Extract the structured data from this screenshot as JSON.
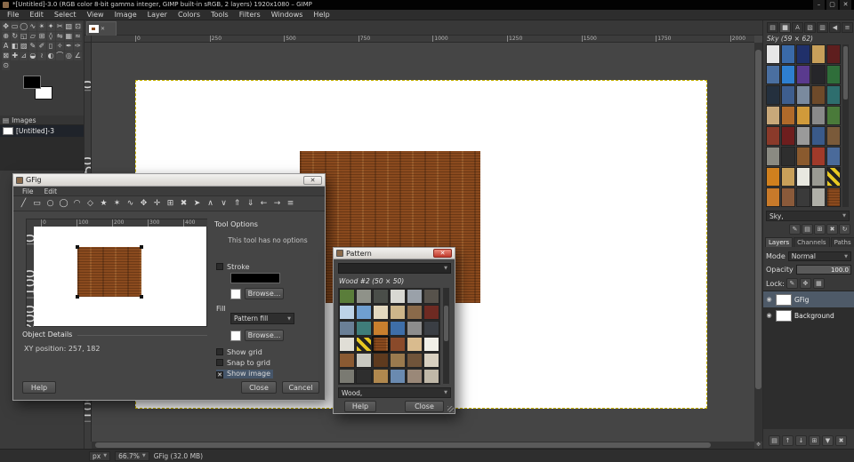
{
  "ui": {
    "dropdown_glyph": "▼",
    "close_glyph": "✕",
    "eye_glyph": "◉",
    "nav_glyph": "✥"
  },
  "window": {
    "title": "*[Untitled]-3.0 (RGB color 8-bit gamma integer, GIMP built-in sRGB, 2 layers) 1920x1080 – GIMP",
    "minimize": "–",
    "maximize": "▢",
    "close": "✕"
  },
  "menubar": [
    "File",
    "Edit",
    "Select",
    "View",
    "Image",
    "Layer",
    "Colors",
    "Tools",
    "Filters",
    "Windows",
    "Help"
  ],
  "toolbox_tools": [
    {
      "name": "move",
      "glyph": "✥"
    },
    {
      "name": "rect-select",
      "glyph": "▭"
    },
    {
      "name": "ellipse-select",
      "glyph": "◯"
    },
    {
      "name": "free-select",
      "glyph": "∿"
    },
    {
      "name": "fuzzy-select",
      "glyph": "✴"
    },
    {
      "name": "select-by-color",
      "glyph": "✦"
    },
    {
      "name": "scissors",
      "glyph": "✂"
    },
    {
      "name": "foreground-select",
      "glyph": "▧"
    },
    {
      "name": "crop",
      "glyph": "⊡"
    },
    {
      "name": "unified-transform",
      "glyph": "⊕"
    },
    {
      "name": "rotate",
      "glyph": "↻"
    },
    {
      "name": "scale",
      "glyph": "◱"
    },
    {
      "name": "shear",
      "glyph": "▱"
    },
    {
      "name": "handle-transform",
      "glyph": "⊞"
    },
    {
      "name": "perspective",
      "glyph": "◊"
    },
    {
      "name": "flip",
      "glyph": "⇋"
    },
    {
      "name": "cage-transform",
      "glyph": "▦"
    },
    {
      "name": "warp",
      "glyph": "≈"
    },
    {
      "name": "text",
      "glyph": "A"
    },
    {
      "name": "bucket-fill",
      "glyph": "◧"
    },
    {
      "name": "gradient",
      "glyph": "▨"
    },
    {
      "name": "pencil",
      "glyph": "✎"
    },
    {
      "name": "paintbrush",
      "glyph": "✐"
    },
    {
      "name": "eraser",
      "glyph": "▯"
    },
    {
      "name": "airbrush",
      "glyph": "✧"
    },
    {
      "name": "ink",
      "glyph": "✒"
    },
    {
      "name": "mypaint-brush",
      "glyph": "✑"
    },
    {
      "name": "clone",
      "glyph": "⊠"
    },
    {
      "name": "heal",
      "glyph": "✚"
    },
    {
      "name": "perspective-clone",
      "glyph": "⊿"
    },
    {
      "name": "blur-sharpen",
      "glyph": "◒"
    },
    {
      "name": "smudge",
      "glyph": "≀"
    },
    {
      "name": "dodge-burn",
      "glyph": "◐"
    },
    {
      "name": "paths",
      "glyph": "⌒"
    },
    {
      "name": "color-picker",
      "glyph": "◎"
    },
    {
      "name": "measure",
      "glyph": "∠"
    },
    {
      "name": "zoom",
      "glyph": "⊙"
    }
  ],
  "images_panel": {
    "title": "Images",
    "item": "[Untitled]-3"
  },
  "ruler": {
    "h": [
      "0",
      "250",
      "500",
      "750",
      "1000",
      "1250",
      "1500",
      "1750",
      "2000"
    ],
    "v": [
      "0",
      "250",
      "500",
      "750",
      "1000"
    ]
  },
  "statusbar": {
    "unit": "px",
    "zoom": "66.7%",
    "message": "GFig (32.0 MB)"
  },
  "gfig": {
    "title": "GFig",
    "menus": [
      "File",
      "Edit"
    ],
    "toolbar": [
      {
        "name": "line",
        "glyph": "╱"
      },
      {
        "name": "rectangle",
        "glyph": "▭"
      },
      {
        "name": "circle",
        "glyph": "○"
      },
      {
        "name": "ellipse",
        "glyph": "◯"
      },
      {
        "name": "arc",
        "glyph": "◠"
      },
      {
        "name": "polygon",
        "glyph": "◇"
      },
      {
        "name": "star",
        "glyph": "★"
      },
      {
        "name": "spiral",
        "glyph": "✶"
      },
      {
        "name": "bezier",
        "glyph": "∿"
      },
      {
        "name": "move-object",
        "glyph": "✥"
      },
      {
        "name": "move-point",
        "glyph": "✛"
      },
      {
        "name": "copy-object",
        "glyph": "⊞"
      },
      {
        "name": "delete-object",
        "glyph": "✖"
      },
      {
        "name": "select-object",
        "glyph": "➤"
      },
      {
        "name": "raise",
        "glyph": "∧"
      },
      {
        "name": "lower",
        "glyph": "∨"
      },
      {
        "name": "top",
        "glyph": "⇑"
      },
      {
        "name": "bottom",
        "glyph": "⇓"
      },
      {
        "name": "back",
        "glyph": "←"
      },
      {
        "name": "forward",
        "glyph": "→"
      },
      {
        "name": "show-all",
        "glyph": "≡"
      }
    ],
    "preview_ruler_h": [
      "0",
      "100",
      "200",
      "300",
      "400"
    ],
    "preview_ruler_v": [
      "0",
      "100",
      "200"
    ],
    "tool_options_title": "Tool Options",
    "no_options_text": "This tool has no options",
    "stroke_label": "Stroke",
    "browse_label": "Browse...",
    "fill_label": "Fill",
    "fill_type": "Pattern fill",
    "show_grid": "Show grid",
    "snap_to_grid": "Snap to grid",
    "show_image": "Show image",
    "object_details_title": "Object Details",
    "xy_position": "XY position:  257, 182",
    "help": "Help",
    "close_btn": "Close",
    "cancel_btn": "Cancel"
  },
  "pattern_dialog": {
    "title": "Pattern",
    "selected_name": "Wood #2 (50 × 50)",
    "tag": "Wood,",
    "selected_index": 20,
    "swatches": [
      "#5a7d3a",
      "#8f9289",
      "#4a4e49",
      "#d8d8d2",
      "#9aa1a9",
      "#57524b",
      "#bcd3e8",
      "#6f9fd0",
      "#e3d9c0",
      "#cdb68a",
      "#8a6a4a",
      "#6e2a22",
      "#6a7f96",
      "#3f7d7a",
      "#c87f2e",
      "#3e6ea8",
      "#8d8d8d",
      "#3a3e44",
      "#e0ded6",
      "hazard",
      "wood",
      "#8a4a2a",
      "#d9bb8e",
      "#f0efe8",
      "#8a5a32",
      "#c8c8c0",
      "#5e3a1e",
      "#9a7a4e",
      "#70543a",
      "#d8d0c0",
      "#7a7a72",
      "#2e2e2e",
      "#b0884e",
      "#6a8ab0",
      "#9a8878",
      "#c0b8a8"
    ],
    "help": "Help",
    "close_btn": "Close"
  },
  "right_dock": {
    "tab_icons": [
      {
        "name": "brushes",
        "glyph": "▤"
      },
      {
        "name": "patterns",
        "glyph": "▦"
      },
      {
        "name": "fonts",
        "glyph": "A"
      },
      {
        "name": "gradients",
        "glyph": "▧"
      },
      {
        "name": "document-history",
        "glyph": "▥"
      }
    ],
    "panel_left_glyph": "◀",
    "panel_menu_glyph": "≡",
    "pattern_label": "Sky (59 × 62)",
    "tag": "Sky,",
    "swatches": [
      "#e6e6e6",
      "#3a6aa8",
      "#20306a",
      "#c8a05a",
      "#5e1e1e",
      "#4a6fa0",
      "#2e7fd0",
      "#5a3a8e",
      "#26262a",
      "#2f6e3a",
      "#24303e",
      "#3e5e8e",
      "#7a8a9e",
      "#6e4a2a",
      "#2e6e6e",
      "#c8a87a",
      "#b06a2a",
      "#d09a3a",
      "#8a8a8a",
      "#4a7a3a",
      "#8a3a2a",
      "#6e1e1e",
      "#9a9a9a",
      "#3a5a8a",
      "#7a5a3a",
      "#8a8a82",
      "#2e2e2e",
      "#8a5a2e",
      "#a03a2a",
      "#4a6a9a",
      "#d0801e",
      "#c8a05a",
      "#e8e8e0",
      "#9a9a92",
      "hazard",
      "#c87a2a",
      "#8a5a3a",
      "#3a3a3a",
      "#b0b0a8",
      "wood"
    ],
    "action_icons": [
      {
        "name": "edit-pattern",
        "glyph": "✎"
      },
      {
        "name": "new-pattern",
        "glyph": "▤"
      },
      {
        "name": "duplicate-pattern",
        "glyph": "⊞"
      },
      {
        "name": "delete-pattern",
        "glyph": "✖"
      },
      {
        "name": "refresh-patterns",
        "glyph": "↻"
      }
    ],
    "layers": {
      "tabs": [
        "Layers",
        "Channels",
        "Paths"
      ],
      "mode_label": "Mode",
      "mode_value": "Normal",
      "opacity_label": "Opacity",
      "opacity_value": "100.0",
      "lock_label": "Lock:",
      "lock_icons": [
        {
          "name": "lock-pixels",
          "glyph": "✎"
        },
        {
          "name": "lock-position",
          "glyph": "✥"
        },
        {
          "name": "lock-alpha",
          "glyph": "▦"
        }
      ],
      "rows": [
        {
          "name": "GFig",
          "thumb": "wood",
          "selected": true
        },
        {
          "name": "Background",
          "thumb": "#ffffff",
          "selected": false
        }
      ],
      "action_icons": [
        {
          "name": "new-layer",
          "glyph": "▤"
        },
        {
          "name": "raise-layer",
          "glyph": "↑"
        },
        {
          "name": "lower-layer",
          "glyph": "↓"
        },
        {
          "name": "duplicate-layer",
          "glyph": "⊞"
        },
        {
          "name": "anchor-layer",
          "glyph": "▼"
        },
        {
          "name": "delete-layer",
          "glyph": "✖"
        }
      ]
    }
  },
  "colors": {
    "wood_base": "#8a4a1e",
    "canvas_white": "#ffffff",
    "selection_row": "#4e5a68"
  }
}
